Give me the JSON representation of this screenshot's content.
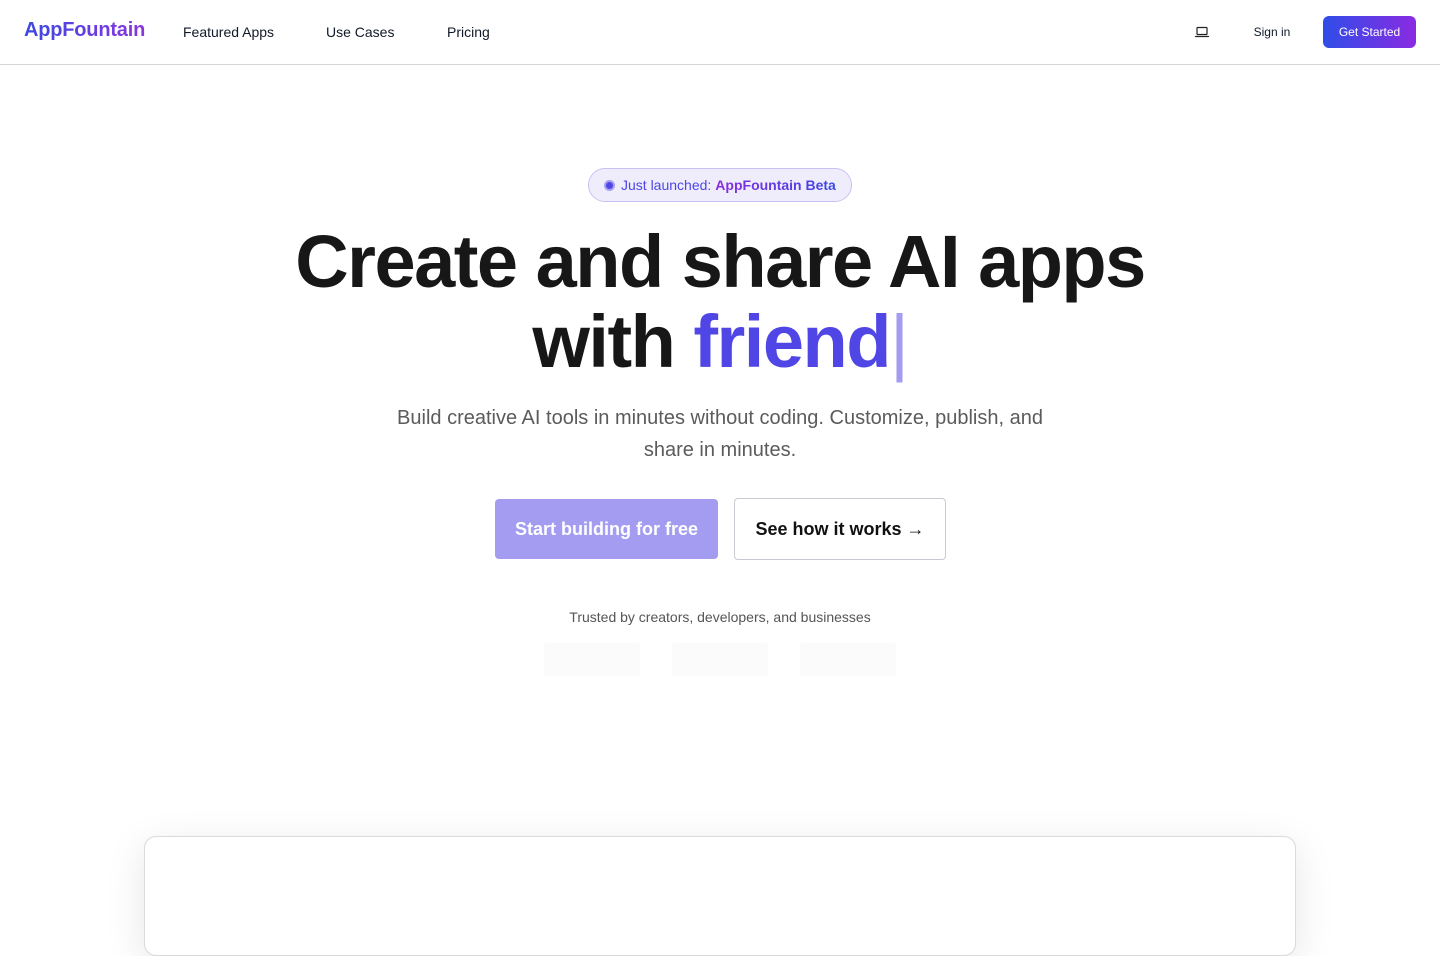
{
  "nav": {
    "logo": "AppFountain",
    "links": [
      "Featured Apps",
      "Use Cases",
      "Pricing"
    ],
    "theme_icon": "laptop-icon",
    "sign_in": "Sign in",
    "get_started": "Get Started"
  },
  "badge": {
    "prefix": "Just launched:",
    "highlight": "AppFountain Beta"
  },
  "hero": {
    "line1": "Create and share AI apps",
    "line2_prefix": "with",
    "line2_accent": "friend",
    "caret": "|",
    "subtitle": "Build creative AI tools in minutes without coding. Customize, publish, and share in minutes.",
    "primary_cta": "Start building for free",
    "secondary_cta": "See how it works →"
  },
  "trusted": {
    "text": "Trusted by creators, developers, and businesses"
  },
  "colors": {
    "accent": "#4f46e5",
    "accent_light": "#a39cf0",
    "gradient_start": "#2f4de8",
    "gradient_end": "#8a2be2"
  }
}
